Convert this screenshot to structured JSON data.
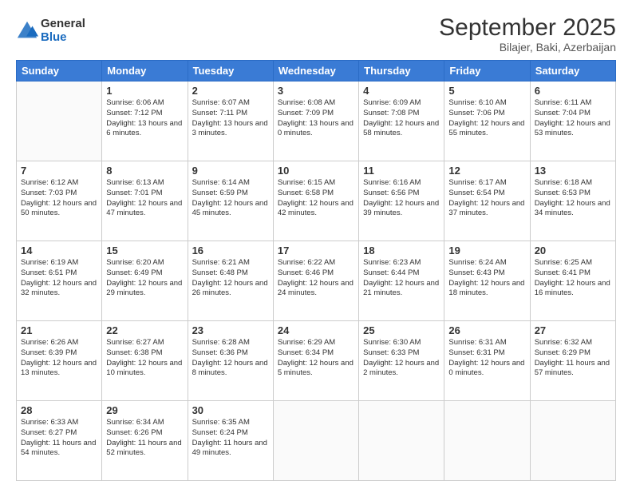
{
  "logo": {
    "general": "General",
    "blue": "Blue"
  },
  "header": {
    "title": "September 2025",
    "subtitle": "Bilajer, Baki, Azerbaijan"
  },
  "days": [
    "Sunday",
    "Monday",
    "Tuesday",
    "Wednesday",
    "Thursday",
    "Friday",
    "Saturday"
  ],
  "weeks": [
    [
      {
        "day": "",
        "sunrise": "",
        "sunset": "",
        "daylight": ""
      },
      {
        "day": "1",
        "sunrise": "6:06 AM",
        "sunset": "7:12 PM",
        "daylight": "13 hours and 6 minutes."
      },
      {
        "day": "2",
        "sunrise": "6:07 AM",
        "sunset": "7:11 PM",
        "daylight": "13 hours and 3 minutes."
      },
      {
        "day": "3",
        "sunrise": "6:08 AM",
        "sunset": "7:09 PM",
        "daylight": "13 hours and 0 minutes."
      },
      {
        "day": "4",
        "sunrise": "6:09 AM",
        "sunset": "7:08 PM",
        "daylight": "12 hours and 58 minutes."
      },
      {
        "day": "5",
        "sunrise": "6:10 AM",
        "sunset": "7:06 PM",
        "daylight": "12 hours and 55 minutes."
      },
      {
        "day": "6",
        "sunrise": "6:11 AM",
        "sunset": "7:04 PM",
        "daylight": "12 hours and 53 minutes."
      }
    ],
    [
      {
        "day": "7",
        "sunrise": "6:12 AM",
        "sunset": "7:03 PM",
        "daylight": "12 hours and 50 minutes."
      },
      {
        "day": "8",
        "sunrise": "6:13 AM",
        "sunset": "7:01 PM",
        "daylight": "12 hours and 47 minutes."
      },
      {
        "day": "9",
        "sunrise": "6:14 AM",
        "sunset": "6:59 PM",
        "daylight": "12 hours and 45 minutes."
      },
      {
        "day": "10",
        "sunrise": "6:15 AM",
        "sunset": "6:58 PM",
        "daylight": "12 hours and 42 minutes."
      },
      {
        "day": "11",
        "sunrise": "6:16 AM",
        "sunset": "6:56 PM",
        "daylight": "12 hours and 39 minutes."
      },
      {
        "day": "12",
        "sunrise": "6:17 AM",
        "sunset": "6:54 PM",
        "daylight": "12 hours and 37 minutes."
      },
      {
        "day": "13",
        "sunrise": "6:18 AM",
        "sunset": "6:53 PM",
        "daylight": "12 hours and 34 minutes."
      }
    ],
    [
      {
        "day": "14",
        "sunrise": "6:19 AM",
        "sunset": "6:51 PM",
        "daylight": "12 hours and 32 minutes."
      },
      {
        "day": "15",
        "sunrise": "6:20 AM",
        "sunset": "6:49 PM",
        "daylight": "12 hours and 29 minutes."
      },
      {
        "day": "16",
        "sunrise": "6:21 AM",
        "sunset": "6:48 PM",
        "daylight": "12 hours and 26 minutes."
      },
      {
        "day": "17",
        "sunrise": "6:22 AM",
        "sunset": "6:46 PM",
        "daylight": "12 hours and 24 minutes."
      },
      {
        "day": "18",
        "sunrise": "6:23 AM",
        "sunset": "6:44 PM",
        "daylight": "12 hours and 21 minutes."
      },
      {
        "day": "19",
        "sunrise": "6:24 AM",
        "sunset": "6:43 PM",
        "daylight": "12 hours and 18 minutes."
      },
      {
        "day": "20",
        "sunrise": "6:25 AM",
        "sunset": "6:41 PM",
        "daylight": "12 hours and 16 minutes."
      }
    ],
    [
      {
        "day": "21",
        "sunrise": "6:26 AM",
        "sunset": "6:39 PM",
        "daylight": "12 hours and 13 minutes."
      },
      {
        "day": "22",
        "sunrise": "6:27 AM",
        "sunset": "6:38 PM",
        "daylight": "12 hours and 10 minutes."
      },
      {
        "day": "23",
        "sunrise": "6:28 AM",
        "sunset": "6:36 PM",
        "daylight": "12 hours and 8 minutes."
      },
      {
        "day": "24",
        "sunrise": "6:29 AM",
        "sunset": "6:34 PM",
        "daylight": "12 hours and 5 minutes."
      },
      {
        "day": "25",
        "sunrise": "6:30 AM",
        "sunset": "6:33 PM",
        "daylight": "12 hours and 2 minutes."
      },
      {
        "day": "26",
        "sunrise": "6:31 AM",
        "sunset": "6:31 PM",
        "daylight": "12 hours and 0 minutes."
      },
      {
        "day": "27",
        "sunrise": "6:32 AM",
        "sunset": "6:29 PM",
        "daylight": "11 hours and 57 minutes."
      }
    ],
    [
      {
        "day": "28",
        "sunrise": "6:33 AM",
        "sunset": "6:27 PM",
        "daylight": "11 hours and 54 minutes."
      },
      {
        "day": "29",
        "sunrise": "6:34 AM",
        "sunset": "6:26 PM",
        "daylight": "11 hours and 52 minutes."
      },
      {
        "day": "30",
        "sunrise": "6:35 AM",
        "sunset": "6:24 PM",
        "daylight": "11 hours and 49 minutes."
      },
      {
        "day": "",
        "sunrise": "",
        "sunset": "",
        "daylight": ""
      },
      {
        "day": "",
        "sunrise": "",
        "sunset": "",
        "daylight": ""
      },
      {
        "day": "",
        "sunrise": "",
        "sunset": "",
        "daylight": ""
      },
      {
        "day": "",
        "sunrise": "",
        "sunset": "",
        "daylight": ""
      }
    ]
  ],
  "labels": {
    "sunrise": "Sunrise:",
    "sunset": "Sunset:",
    "daylight": "Daylight:"
  }
}
